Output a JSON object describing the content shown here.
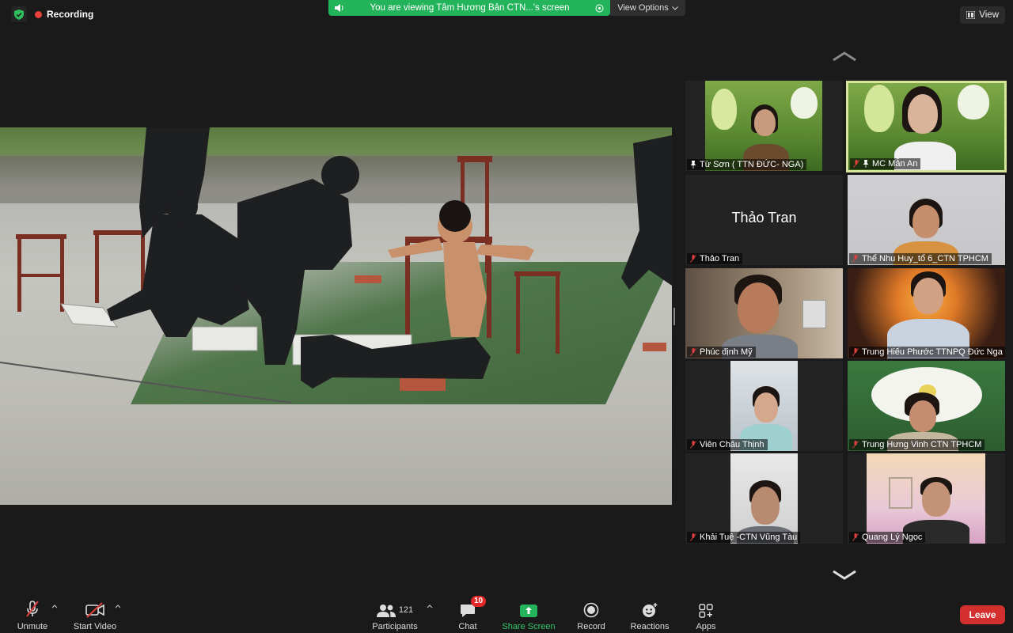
{
  "recording": {
    "label": "Recording"
  },
  "banner": {
    "text": "You are viewing Tâm Hương Bản CTN...'s screen"
  },
  "view_options": {
    "label": "View Options"
  },
  "view_button": {
    "label": "View"
  },
  "participants_tiles": [
    {
      "name": "Từ Sơn ( TTN ĐỨC- NGA)",
      "pinned": true
    },
    {
      "name": "MC Mẫn An",
      "pinned": true,
      "active_speaker": true
    },
    {
      "name": "Thảo Tran",
      "placeholder": "Thảo Tran"
    },
    {
      "name": "Thể Nhu Huy_tổ 6_CTN TPHCM"
    },
    {
      "name": "Phúc định Mỹ"
    },
    {
      "name": "Trung Hiếu Phước TTNPQ Đức Nga"
    },
    {
      "name": "Viên Châu Thịnh"
    },
    {
      "name": "Trung Hưng Vinh CTN TPHCM"
    },
    {
      "name": "Khải Tuệ -CTN Vũng Tàu"
    },
    {
      "name": "Quang Lý Ngọc"
    }
  ],
  "toolbar": {
    "unmute": "Unmute",
    "start_video": "Start Video",
    "participants": "Participants",
    "participants_count": "121",
    "chat": "Chat",
    "chat_badge": "10",
    "share_screen": "Share Screen",
    "record": "Record",
    "reactions": "Reactions",
    "apps": "Apps",
    "leave": "Leave"
  },
  "colors": {
    "accent_green": "#23b35b",
    "leave_red": "#d32f2f",
    "active_border": "#d6e79b"
  }
}
